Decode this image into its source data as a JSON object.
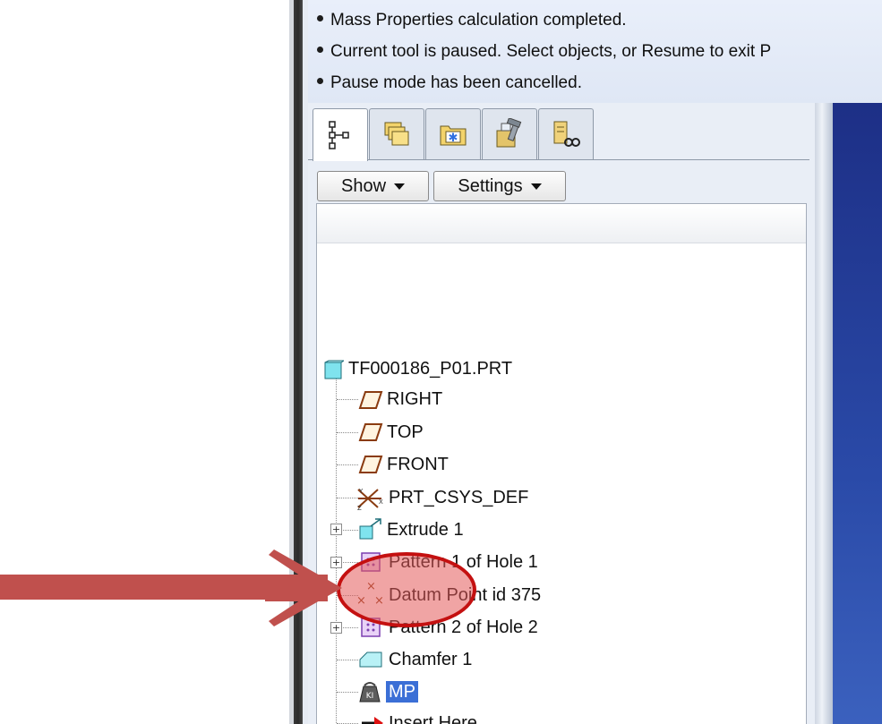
{
  "messages": [
    "Mass Properties calculation completed.",
    "Current tool is paused. Select objects, or Resume to exit P",
    "Pause mode has been cancelled."
  ],
  "navigator": {
    "tabs": [
      {
        "name": "model-tree",
        "icon": "model-tree-icon"
      },
      {
        "name": "folder-browser",
        "icon": "folder-browser-icon"
      },
      {
        "name": "favorites",
        "icon": "favorites-icon"
      },
      {
        "name": "connections",
        "icon": "connections-icon"
      },
      {
        "name": "layers",
        "icon": "layers-icon"
      }
    ],
    "show_label": "Show",
    "settings_label": "Settings"
  },
  "tree": {
    "root": "TF000186_P01.PRT",
    "items": [
      {
        "label": "RIGHT",
        "icon": "datum-plane-icon"
      },
      {
        "label": "TOP",
        "icon": "datum-plane-icon"
      },
      {
        "label": "FRONT",
        "icon": "datum-plane-icon"
      },
      {
        "label": "PRT_CSYS_DEF",
        "icon": "coordinate-system-icon"
      },
      {
        "label": "Extrude 1",
        "icon": "extrude-icon"
      },
      {
        "label": "Pattern 1 of Hole 1",
        "icon": "pattern-icon"
      },
      {
        "label": "Datum Point id 375",
        "icon": "datum-point-icon"
      },
      {
        "label": "Pattern 2 of Hole 2",
        "icon": "pattern-icon"
      },
      {
        "label": "Chamfer 1",
        "icon": "chamfer-icon"
      },
      {
        "label": "MP",
        "icon": "mass-properties-icon"
      },
      {
        "label": "Insert Here",
        "icon": "insert-arrow-icon"
      }
    ]
  },
  "annotation": {
    "arrow_color": "#c0504d",
    "circle_color": "#c41010"
  }
}
